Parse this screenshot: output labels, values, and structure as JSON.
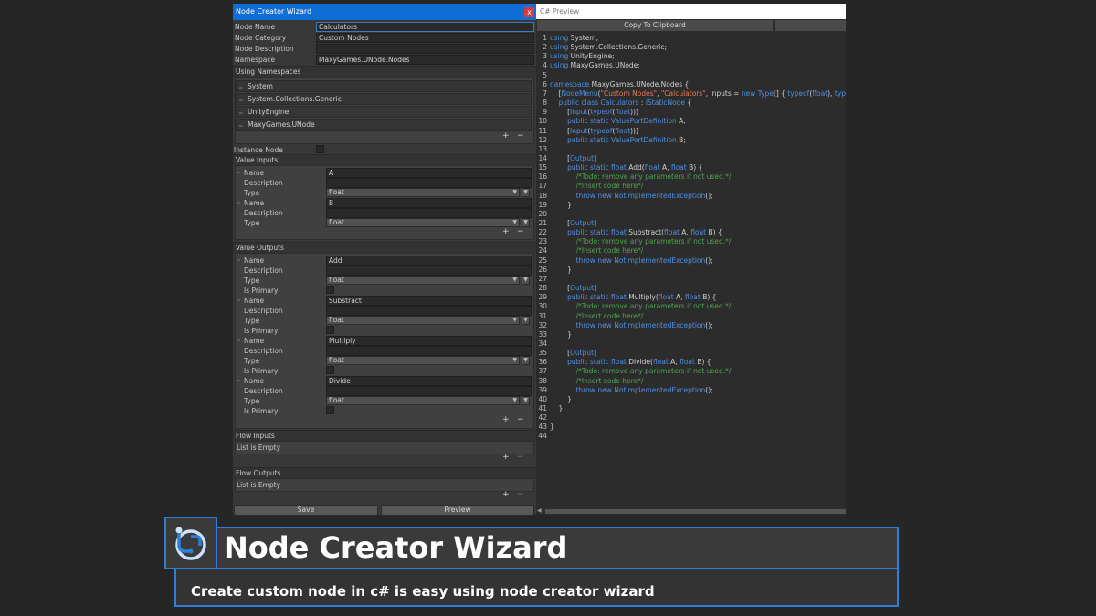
{
  "window": {
    "title": "Node Creator Wizard",
    "close": "x",
    "fields": [
      {
        "label": "Node Name",
        "value": "Calculators"
      },
      {
        "label": "Node Category",
        "value": "Custom Nodes"
      },
      {
        "label": "Node Description",
        "value": ""
      },
      {
        "label": "Namespace",
        "value": "MaxyGames.UNode.Nodes"
      }
    ],
    "using_namespaces": {
      "header": "Using Namespaces",
      "items": [
        "System",
        "System.Collections.Generic",
        "UnityEngine",
        "MaxyGames.UNode"
      ]
    },
    "instance_node": "Instance Node",
    "value_inputs": {
      "header": "Value Inputs",
      "items": [
        {
          "name": "A",
          "type": "float"
        },
        {
          "name": "B",
          "type": "float"
        }
      ],
      "labels": {
        "name": "Name",
        "description": "Description",
        "type": "Type",
        "is_primary": "Is Primary"
      }
    },
    "value_outputs": {
      "header": "Value Outputs",
      "items": [
        {
          "name": "Add",
          "type": "float"
        },
        {
          "name": "Substract",
          "type": "float"
        },
        {
          "name": "Multiply",
          "type": "float"
        },
        {
          "name": "Divide",
          "type": "float"
        }
      ]
    },
    "flow_inputs": {
      "header": "Flow Inputs",
      "empty": "List is Empty"
    },
    "flow_outputs": {
      "header": "Flow Outputs",
      "empty": "List is Empty"
    },
    "plus": "+",
    "minus": "−",
    "save": "Save",
    "preview": "Preview"
  },
  "preview": {
    "header": "C# Preview",
    "copy": "Copy To Clipboard",
    "lines": [
      "<k>using</k> System;",
      "<k>using</k> System.Collections.Generic;",
      "<k>using</k> UnityEngine;",
      "<k>using</k> MaxyGames.UNode;",
      "",
      "<k>namespace</k> MaxyGames.UNode.Nodes {",
      "    [<k>NodeMenu</k>(<s>\"Custom Nodes\"</s>, <s>\"Calculators\"</s>, inputs = <k>new</k> <k>Type</k>[] { <k>typeof</k>(<k>float</k>), <k>typeof</k>(<k>float</k>) },",
      "    <k>public class</k> <k>Calculators</k> : <k>IStaticNode</k> {",
      "        [<k>Input</k>(<k>typeof</k>(<k>float</k>))]",
      "        <k>public static</k> <k>ValuePortDefinition</k> A;",
      "        [<k>Input</k>(<k>typeof</k>(<k>float</k>))]",
      "        <k>public static</k> <k>ValuePortDefinition</k> B;",
      "",
      "        [<k>Output</k>]",
      "        <k>public static float</k> Add(<k>float</k> A, <k>float</k> B) {",
      "            <c>/*Todo: remove any parameters if not used.*/</c>",
      "            <c>/*Insert code here*/</c>",
      "            <k>throw new</k> <k>NotImplementedException</k>();",
      "        }",
      "",
      "        [<k>Output</k>]",
      "        <k>public static float</k> Substract(<k>float</k> A, <k>float</k> B) {",
      "            <c>/*Todo: remove any parameters if not used.*/</c>",
      "            <c>/*Insert code here*/</c>",
      "            <k>throw new</k> <k>NotImplementedException</k>();",
      "        }",
      "",
      "        [<k>Output</k>]",
      "        <k>public static float</k> Multiply(<k>float</k> A, <k>float</k> B) {",
      "            <c>/*Todo: remove any parameters if not used.*/</c>",
      "            <c>/*Insert code here*/</c>",
      "            <k>throw new</k> <k>NotImplementedException</k>();",
      "        }",
      "",
      "        [<k>Output</k>]",
      "        <k>public static float</k> Divide(<k>float</k> A, <k>float</k> B) {",
      "            <c>/*Todo: remove any parameters if not used.*/</c>",
      "            <c>/*Insert code here*/</c>",
      "            <k>throw new</k> <k>NotImplementedException</k>();",
      "        }",
      "    }",
      "",
      "}",
      ""
    ]
  },
  "banner": {
    "title": "Node Creator Wizard",
    "subtitle": "Create custom node in c# is easy using node creator wizard",
    "logo_icon": "unode-logo-icon"
  },
  "colors": {
    "accent": "#0f6ed6",
    "banner_border": "#2f7fd8",
    "keyword": "#4d8fe0",
    "string": "#e07b5a",
    "comment": "#4fa34f"
  }
}
